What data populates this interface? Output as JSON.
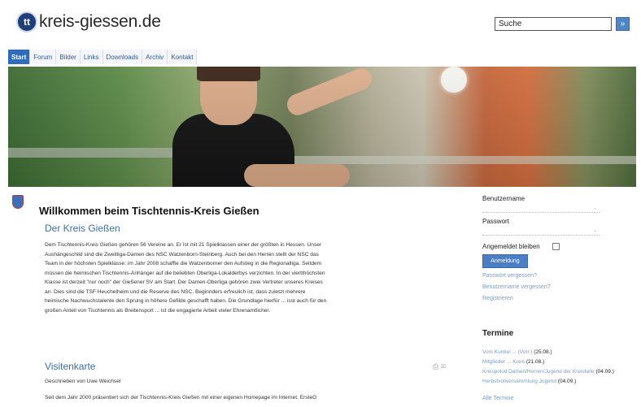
{
  "header": {
    "logo_badge": "tt",
    "logo_text": "kreis-giessen.de",
    "search_value": "Suche",
    "search_button_glyph": "»"
  },
  "nav": {
    "items": [
      {
        "label": "Start",
        "active": true
      },
      {
        "label": "Forum",
        "active": false
      },
      {
        "label": "Bilder",
        "active": false
      },
      {
        "label": "Links",
        "active": false
      },
      {
        "label": "Downloads",
        "active": false
      },
      {
        "label": "Archiv",
        "active": false
      },
      {
        "label": "Kontakt",
        "active": false
      }
    ]
  },
  "main": {
    "welcome_title": "Willkommen beim Tischtennis-Kreis Gießen",
    "section1_title": "Der Kreis Gießen",
    "section1_lines": [
      "Dem Tischtennis-Kreis Gießen gehören 56 Vereine an. Er ist mit 21 Spielklassen einer der größten in Hessen. Unser",
      "Aushängeschild sind die Zweitliga-Damen des NSC Watzenborn-Steinberg. Auch bei den Herren stellt der NSC das",
      "Team in der höchsten Spielklasse: im Jahr 2008 schaffte die Watzenborner den Aufstieg in die Regionalliga. Seitdem",
      "müssen die heimischen Tischtennis-Anhänger auf die beliebten Oberliga-Lokalderbys verzichten. In der viertthöchsten",
      "Klasse ist derzeit \"nur noch\" der Gießener SV am Start. Der Damen-Oberliga gehören zwei Vertreter unseres Kreises",
      "an. Dies sind die TSF Heuchelheim und die Reserve des NSC. Beginnders erfreulich ist, dass zuletzt mehrere",
      "heimische Nachwuchstalente den Sprung in höhere Gefilde geschafft haben. Die Grundlage hierfür ... isst auch für den",
      "großen Anteil von Tischtennis als Breitensport ... ist die engagierte Arbeit vieler Ehrenamtlicher."
    ],
    "section2_title": "Visitenkarte",
    "author": "Geschrieben von Uwe Weichsel",
    "section2_line": "Seit dem Jahr 2000 präsentiert sich der Tischtennis-Kreis Gießen mit einer eigenen Homepage im Internet. ErsteG",
    "print_icon": "⎙ ✉"
  },
  "sidebar": {
    "username_label": "Benutzername",
    "password_label": "Passwort",
    "remember_label": "Angemeldet bleiben",
    "login_label": "Anmeldung",
    "links": [
      "Passwort vergessen?",
      "Benutzername vergessen?",
      "Registrieren"
    ],
    "termine_title": "Termine",
    "termine": [
      {
        "name": "Vom Kunkel ... (Vorr.)",
        "date": "(25.08.)"
      },
      {
        "name": "Mitglieder ... Kreis",
        "date": "(21.08.)"
      },
      {
        "name": "Kreispokal Damen/Herren/Jugend der Kreisteile",
        "date": "(04.09.)"
      },
      {
        "name": "Herbstvollversammlung Jugend",
        "date": "(04.09.)"
      }
    ],
    "more_link": "Alle Termine"
  }
}
